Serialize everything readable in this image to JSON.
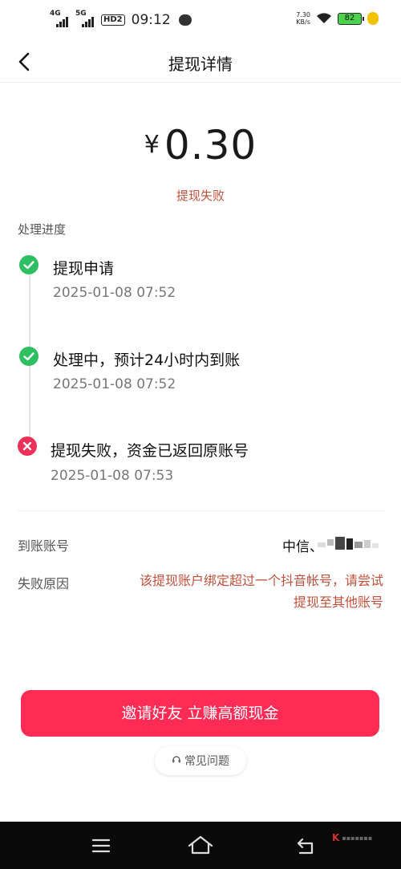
{
  "status_bar": {
    "net1": "4G",
    "net2": "5G",
    "hd": "HD2",
    "time": "09:12",
    "speed": "7.30",
    "speed_unit": "KB/s",
    "battery": "82"
  },
  "header": {
    "title": "提现详情"
  },
  "amount": {
    "currency": "¥",
    "value": "0.30"
  },
  "status_text": "提现失败",
  "progress": {
    "label": "处理进度",
    "steps": [
      {
        "title": "提现申请",
        "time": "2025-01-08 07:52",
        "state": "done"
      },
      {
        "title": "处理中，预计24小时内到账",
        "time": "2025-01-08 07:52",
        "state": "done"
      },
      {
        "title": "提现失败，资金已返回原账号",
        "time": "2025-01-08 07:53",
        "state": "failed"
      }
    ]
  },
  "details": {
    "account_label": "到账账号",
    "account_value": "中信、",
    "reason_label": "失败原因",
    "reason_line1": "该提现账户绑定超过一个抖音帐号，请尝试",
    "reason_line2": "提现至其他账号"
  },
  "invite_button": "邀请好友 立赚高额现金",
  "faq_button": "常见问题",
  "colors": {
    "accent": "#fe2c55",
    "error_text": "#c0503b",
    "success": "#2fbf63",
    "failed": "#ec3057"
  }
}
